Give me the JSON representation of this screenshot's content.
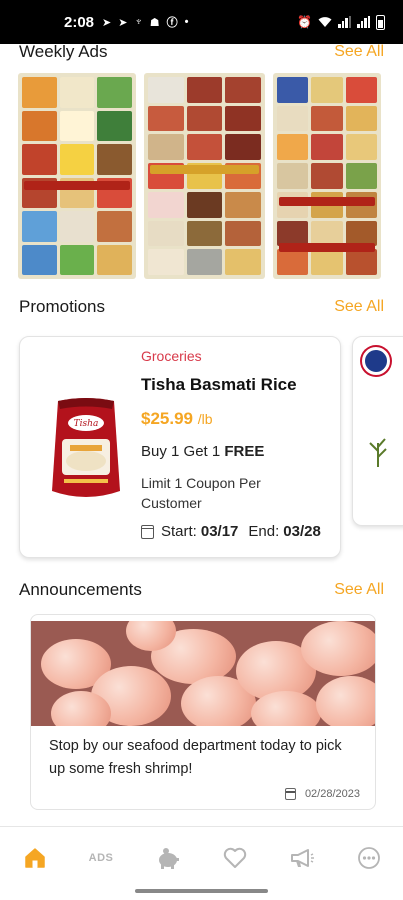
{
  "status_bar": {
    "time": "2:08",
    "left_icons": [
      "telegram-icon",
      "telegram-icon",
      "trophy-icon",
      "hat-icon",
      "facebook-icon",
      "dot-icon"
    ],
    "right_icons": [
      "alarm-icon",
      "wifi-icon",
      "signal-x-icon",
      "signal-icon",
      "battery-icon"
    ]
  },
  "weekly_ads": {
    "title": "Weekly Ads",
    "see_all": "See All"
  },
  "promotions": {
    "title": "Promotions",
    "see_all": "See All",
    "items": [
      {
        "category": "Groceries",
        "name": "Tisha Basmati Rice",
        "price": "$25.99",
        "unit": "/lb",
        "offer_prefix": "Buy 1 Get 1 ",
        "offer_bold": "FREE",
        "limit": "Limit 1 Coupon Per Customer",
        "start_label": "Start:",
        "start_date": "03/17",
        "end_label": "End:",
        "end_date": "03/28",
        "brand": "Tisha"
      }
    ]
  },
  "announcements": {
    "title": "Announcements",
    "see_all": "See All",
    "items": [
      {
        "text": "Stop by our seafood department today to pick up some fresh shrimp!",
        "date": "02/28/2023"
      }
    ]
  },
  "bottom_nav": {
    "items": [
      {
        "icon": "home-icon",
        "active": true
      },
      {
        "label": "ADS"
      },
      {
        "icon": "piggy-bank-icon"
      },
      {
        "icon": "heart-icon"
      },
      {
        "icon": "megaphone-icon"
      },
      {
        "icon": "more-icon"
      }
    ]
  },
  "colors": {
    "accent": "#f5a623",
    "category": "#d83a4a",
    "nav_inactive": "#b5b5b5"
  }
}
